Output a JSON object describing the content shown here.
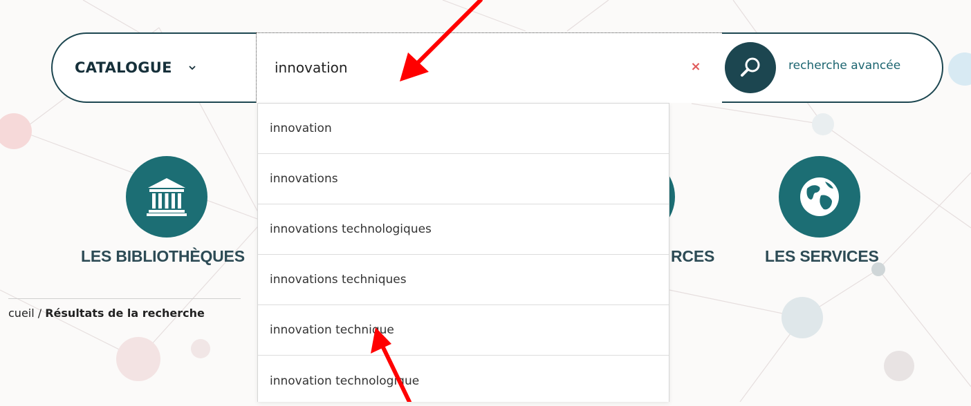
{
  "search": {
    "scope_label": "CATALOGUE",
    "query": "innovation",
    "clear_label": "×",
    "advanced_label": "recherche avancée"
  },
  "nav": {
    "libraries_label": "LES BIBLIOTHÈQUES",
    "resources_label_partial": "RCES",
    "services_label": "LES SERVICES"
  },
  "breadcrumb": {
    "home_partial": "cueil",
    "separator": " / ",
    "current": "Résultats de la recherche"
  },
  "suggestions": [
    "innovation",
    "innovations",
    "innovations technologiques",
    "innovations techniques",
    "innovation technique",
    "innovation technologique"
  ],
  "colors": {
    "brand_dark": "#1c4650",
    "brand_teal": "#1c6e74",
    "annotation_arrow": "#ff0000",
    "clear_x": "#e05a5a"
  },
  "icons": {
    "scope_chevron": "chevron-down-icon",
    "search": "search-icon",
    "libraries": "library-building-icon",
    "services": "globe-icon"
  }
}
